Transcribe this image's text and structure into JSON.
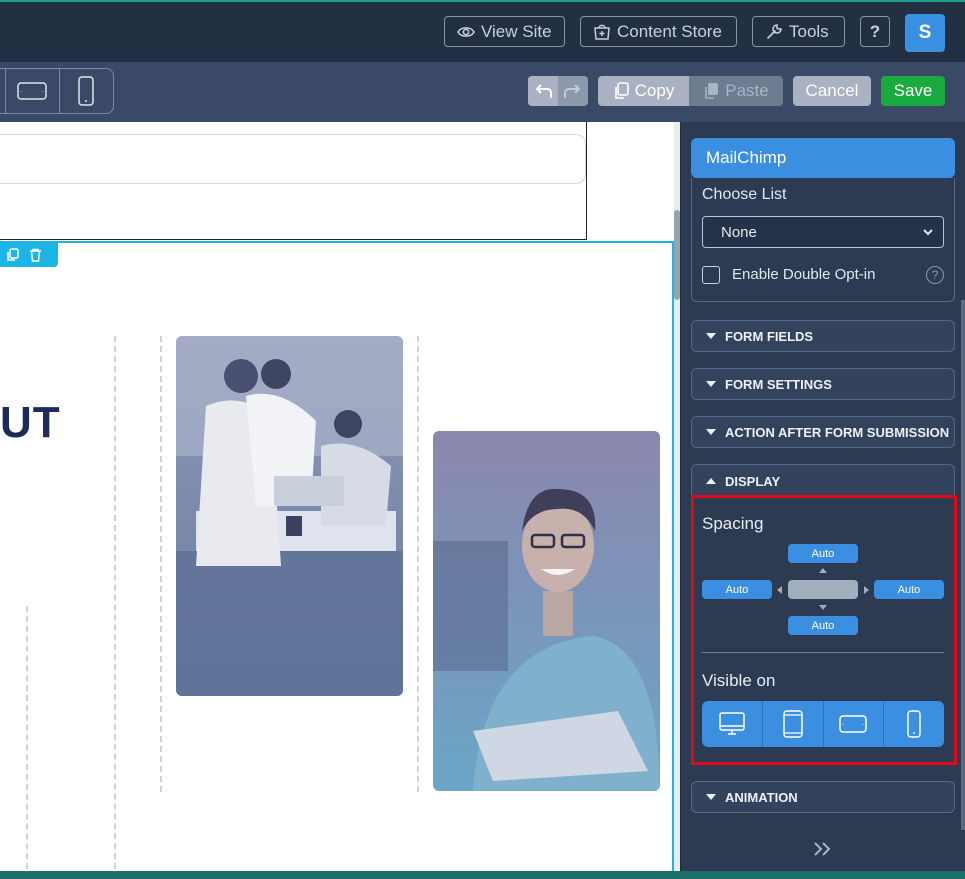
{
  "topbar": {
    "view_site": "View Site",
    "content_store": "Content Store",
    "tools": "Tools",
    "help": "?",
    "avatar": "S"
  },
  "toolbar": {
    "copy": "Copy",
    "paste": "Paste",
    "cancel": "Cancel",
    "save": "Save"
  },
  "canvas": {
    "heading_fragment": "UT"
  },
  "panel": {
    "mailchimp_tab": "MailChimp",
    "choose_list_label": "Choose List",
    "choose_list_value": "None",
    "double_optin_label": "Enable Double Opt-in",
    "help_glyph": "?",
    "sections": {
      "form_fields": "FORM FIELDS",
      "form_settings": "FORM SETTINGS",
      "action_after": "ACTION AFTER FORM SUBMISSION",
      "display": "DISPLAY",
      "animation": "ANIMATION"
    },
    "display": {
      "spacing_label": "Spacing",
      "spacing_top": "Auto",
      "spacing_left": "Auto",
      "spacing_right": "Auto",
      "spacing_bottom": "Auto",
      "visible_on_label": "Visible on",
      "visible_devices": [
        "desktop-icon",
        "tablet-portrait-icon",
        "tablet-landscape-icon",
        "mobile-icon"
      ]
    }
  },
  "colors": {
    "accent": "#3a8fe0",
    "save": "#1aab3e",
    "highlight": "#e00b16",
    "selection": "#1cb6e6",
    "heading": "#1f2a5c"
  }
}
